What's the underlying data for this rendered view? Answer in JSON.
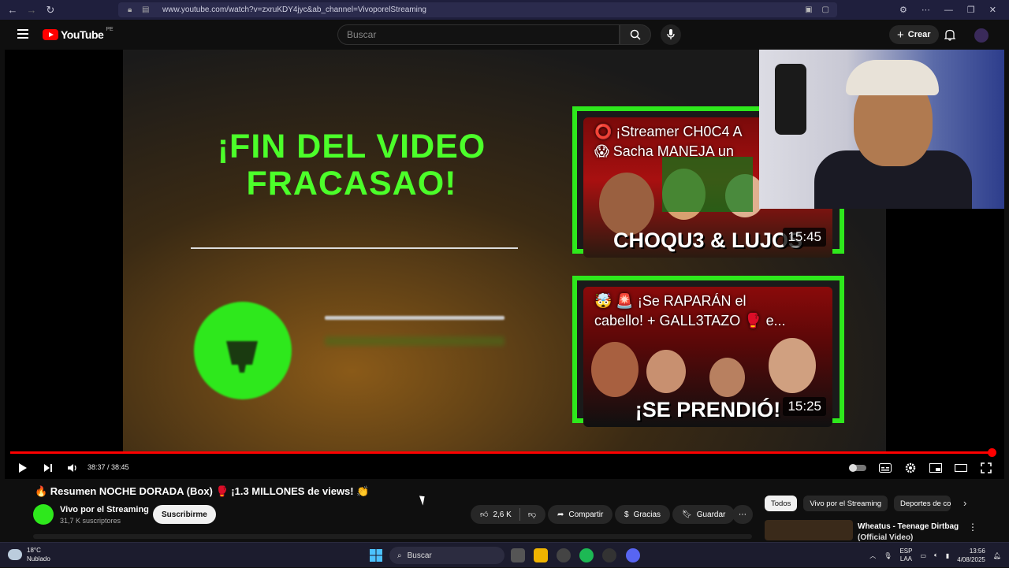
{
  "browser": {
    "url": "www.youtube.com/watch?v=zxruKDY4jyc&ab_channel=VivoporelStreaming",
    "icons": [
      "back-icon",
      "forward-icon",
      "refresh-icon",
      "lock-icon",
      "tune-icon"
    ]
  },
  "header": {
    "logo_text": "YouTube",
    "country_code": "PE",
    "search_placeholder": "Buscar",
    "create_label": "Crear"
  },
  "player": {
    "end_title_line1": "¡FIN DEL VIDEO",
    "end_title_line2": "FRACASAO!",
    "current_time": "38:37 / 38:45",
    "progress": 0.996,
    "cards": [
      {
        "line1": "⭕ ¡Streamer CH0C4 A",
        "line2": "😱 Sacha MANEJA un",
        "overlay": "CHOQU3 & LUJOS",
        "duration": "15:45"
      },
      {
        "line1": "🤯 🚨 ¡Se RAPARÁN el",
        "line2": "cabello! + GALL3TAZO 🥊 e...",
        "overlay": "¡SE PRENDIÓ!",
        "duration": "15:25"
      }
    ]
  },
  "video": {
    "title": "🔥 Resumen NOCHE DORADA (Box) 🥊 ¡1.3 MILLONES de views! 👏",
    "channel_name": "Vivo por el Streaming",
    "subscribers": "31,7 K suscriptores",
    "subscribe_label": "Suscribirme",
    "likes": "2,6 K",
    "share_label": "Compartir",
    "thanks_label": "Gracias",
    "save_label": "Guardar"
  },
  "sidebar": {
    "chips": [
      "Todos",
      "Vivo por el Streaming",
      "Deportes de co"
    ],
    "rec_title": "Wheatus - Teenage Dirtbag",
    "rec_subtitle": "(Official Video)"
  },
  "taskbar": {
    "temperature": "18°C",
    "weather": "Nublado",
    "search_label": "Buscar",
    "lang1": "ESP",
    "lang2": "LAA",
    "time": "13:56",
    "date": "4/08/2025"
  }
}
